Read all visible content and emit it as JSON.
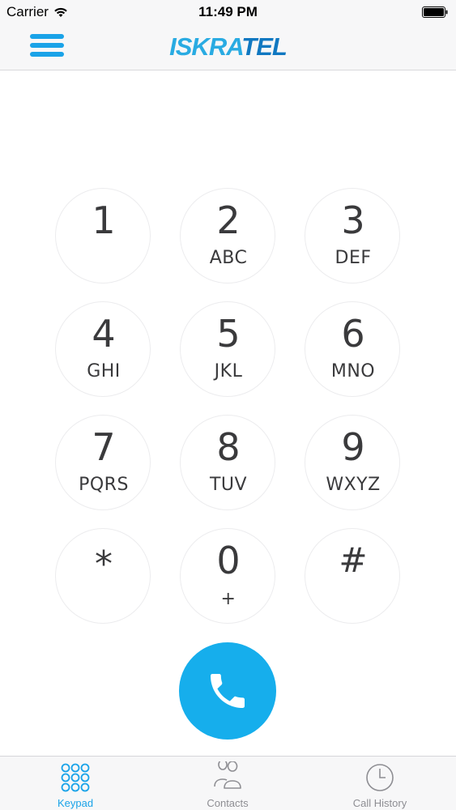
{
  "status_bar": {
    "carrier": "Carrier",
    "time": "11:49 PM"
  },
  "nav": {
    "logo_part1": "ISKRA",
    "logo_part2": "TEL",
    "menu_icon": "hamburger-icon"
  },
  "colors": {
    "accent": "#1aa3e8",
    "call_button": "#16aeec",
    "logo_light": "#29abe2",
    "logo_dark": "#1078c1",
    "key_border": "#ececee",
    "inactive_tab": "#8e8e93"
  },
  "keypad": {
    "keys": [
      {
        "digit": "1",
        "letters": ""
      },
      {
        "digit": "2",
        "letters": "ABC"
      },
      {
        "digit": "3",
        "letters": "DEF"
      },
      {
        "digit": "4",
        "letters": "GHI"
      },
      {
        "digit": "5",
        "letters": "JKL"
      },
      {
        "digit": "6",
        "letters": "MNO"
      },
      {
        "digit": "7",
        "letters": "PQRS"
      },
      {
        "digit": "8",
        "letters": "TUV"
      },
      {
        "digit": "9",
        "letters": "WXYZ"
      },
      {
        "digit": "*",
        "letters": ""
      },
      {
        "digit": "0",
        "letters": "+"
      },
      {
        "digit": "#",
        "letters": ""
      }
    ]
  },
  "call_button": {
    "icon": "phone-icon"
  },
  "tab_bar": {
    "tabs": [
      {
        "label": "Keypad",
        "icon": "keypad-grid-icon",
        "active": true
      },
      {
        "label": "Contacts",
        "icon": "contacts-icon",
        "active": false
      },
      {
        "label": "Call History",
        "icon": "clock-icon",
        "active": false
      }
    ]
  }
}
